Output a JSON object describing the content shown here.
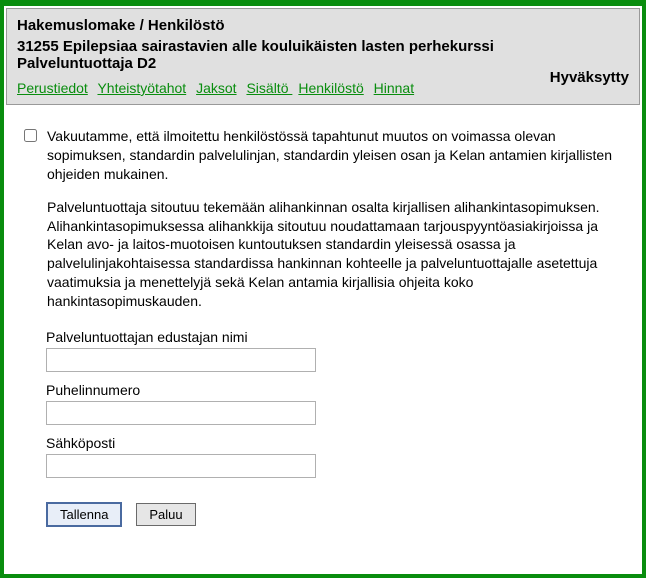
{
  "header": {
    "title": "Hakemuslomake / Henkilöstö",
    "subtitle": "31255 Epilepsiaa sairastavien alle kouluikäisten lasten perhekurssi Palveluntuottaja D2",
    "status": "Hyväksytty"
  },
  "tabs": {
    "perustiedot": "Perustiedot",
    "yhteistyotahot": "Yhteistyötahot",
    "jaksot": "Jaksot",
    "sisalto": "Sisältö ",
    "henkilosto": "Henkilöstö",
    "hinnat": "Hinnat"
  },
  "content": {
    "declaration_p1": "Vakuutamme, että ilmoitettu henkilöstössä tapahtunut muutos on voimassa olevan sopimuksen, standardin palvelulinjan, standardin yleisen osan ja Kelan antamien kirjallisten ohjeiden mukainen.",
    "declaration_p2": "Palveluntuottaja sitoutuu tekemään alihankinnan osalta kirjallisen alihankintasopimuksen. Alihankintasopimuksessa alihankkija sitoutuu noudattamaan tarjouspyyntöasiakirjoissa ja Kelan avo- ja laitos-muotoisen kuntoutuksen standardin yleisessä osassa ja palvelulinjakohtaisessa standardissa hankinnan kohteelle ja palveluntuottajalle asetettuja vaatimuksia ja menettelyjä sekä Kelan antamia kirjallisia ohjeita koko hankintasopimuskauden."
  },
  "form": {
    "rep_name_label": "Palveluntuottajan edustajan nimi",
    "rep_name_value": "",
    "phone_label": "Puhelinnumero",
    "phone_value": "",
    "email_label": "Sähköposti",
    "email_value": ""
  },
  "buttons": {
    "save": "Tallenna",
    "back": "Paluu"
  }
}
